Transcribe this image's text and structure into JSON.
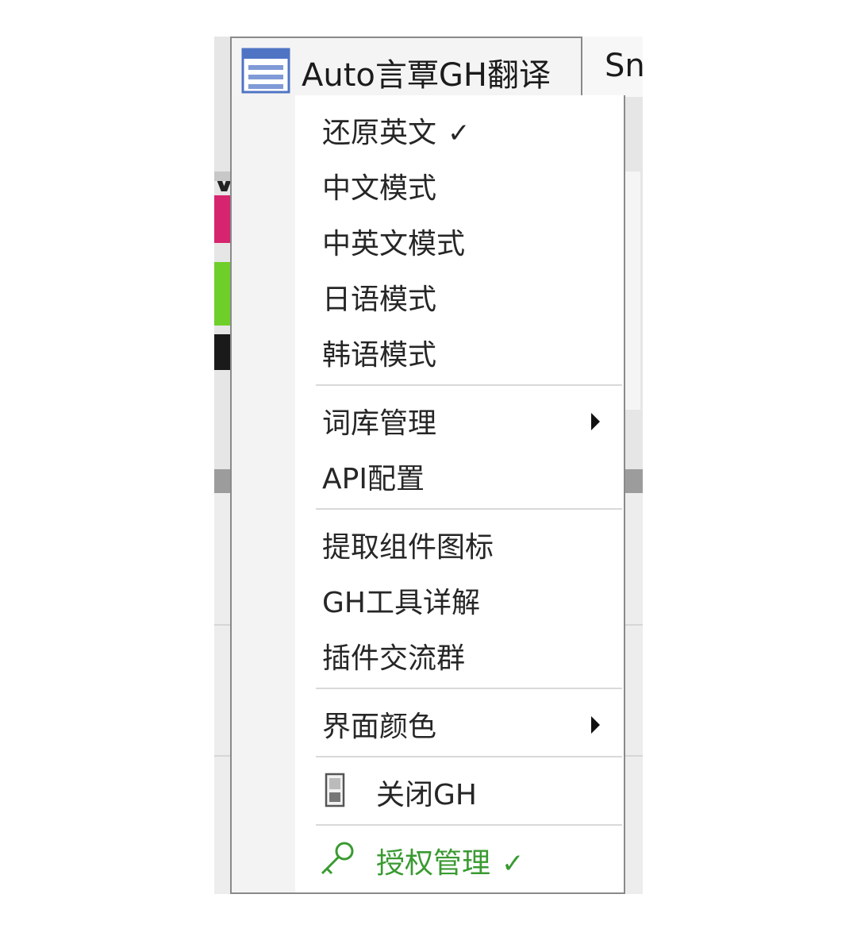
{
  "tab": {
    "title": "Auto言覃GH翻译",
    "next_tab_label": "Sn",
    "icon": "menu-list-icon"
  },
  "menu": {
    "groups": [
      [
        {
          "label": "还原英文",
          "check": "✓"
        },
        {
          "label": "中文模式"
        },
        {
          "label": "中英文模式"
        },
        {
          "label": "日语模式"
        },
        {
          "label": "韩语模式"
        }
      ],
      [
        {
          "label": "词库管理",
          "submenu": true
        },
        {
          "label": "API配置"
        }
      ],
      [
        {
          "label": "提取组件图标"
        },
        {
          "label": "GH工具详解"
        },
        {
          "label": "插件交流群"
        }
      ],
      [
        {
          "label": "界面颜色",
          "submenu": true
        }
      ],
      [
        {
          "label": "关闭GH",
          "icon": "door-icon"
        }
      ],
      [
        {
          "label": "授权管理",
          "check": "✓",
          "icon": "key-icon",
          "color": "#3a9a32"
        }
      ]
    ]
  },
  "background": {
    "left_partial_text": "v"
  }
}
